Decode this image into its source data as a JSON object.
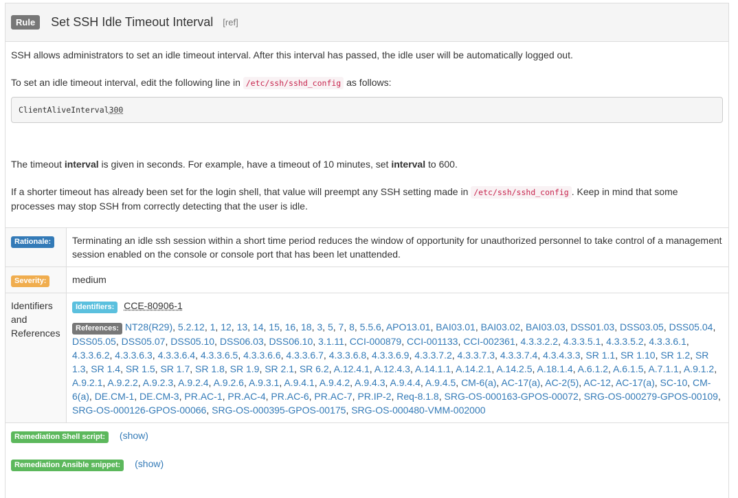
{
  "heading": {
    "badge": "Rule",
    "title": "Set SSH Idle Timeout Interval",
    "ref_link": "[ref]"
  },
  "description": {
    "p1": "SSH allows administrators to set an idle timeout interval. After this interval has passed, the idle user will be automatically logged out.",
    "p2_before": "To set an idle timeout interval, edit the following line in ",
    "p2_code": "/etc/ssh/sshd_config",
    "p2_after": " as follows:",
    "code_line": "ClientAliveInterval ",
    "code_value": "300",
    "p3_a": "The timeout ",
    "p3_b": "interval",
    "p3_c": " is given in seconds. For example, have a timeout of 10 minutes, set ",
    "p3_d": "interval",
    "p3_e": " to 600.",
    "p4_before": "If a shorter timeout has already been set for the login shell, that value will preempt any SSH setting made in ",
    "p4_code": "/etc/ssh/sshd_config",
    "p4_after": ". Keep in mind that some processes may stop SSH from correctly detecting that the user is idle."
  },
  "details": {
    "rationale_label": "Rationale:",
    "rationale_text": "Terminating an idle ssh session within a short time period reduces the window of opportunity for unauthorized personnel to take control of a management session enabled on the console or console port that has been let unattended.",
    "severity_label": "Severity:",
    "severity_value": "medium",
    "identifiers_heading": "Identifiers and References",
    "identifiers_label": "Identifiers:",
    "identifier_value": "CCE-80906-1",
    "references_label": "References:",
    "references": [
      "NT28(R29)",
      "5.2.12",
      "1",
      "12",
      "13",
      "14",
      "15",
      "16",
      "18",
      "3",
      "5",
      "7",
      "8",
      "5.5.6",
      "APO13.01",
      "BAI03.01",
      "BAI03.02",
      "BAI03.03",
      "DSS01.03",
      "DSS03.05",
      "DSS05.04",
      "DSS05.05",
      "DSS05.07",
      "DSS05.10",
      "DSS06.03",
      "DSS06.10",
      "3.1.11",
      "CCI-000879",
      "CCI-001133",
      "CCI-002361",
      "4.3.3.2.2",
      "4.3.3.5.1",
      "4.3.3.5.2",
      "4.3.3.6.1",
      "4.3.3.6.2",
      "4.3.3.6.3",
      "4.3.3.6.4",
      "4.3.3.6.5",
      "4.3.3.6.6",
      "4.3.3.6.7",
      "4.3.3.6.8",
      "4.3.3.6.9",
      "4.3.3.7.2",
      "4.3.3.7.3",
      "4.3.3.7.4",
      "4.3.4.3.3",
      "SR 1.1",
      "SR 1.10",
      "SR 1.2",
      "SR 1.3",
      "SR 1.4",
      "SR 1.5",
      "SR 1.7",
      "SR 1.8",
      "SR 1.9",
      "SR 2.1",
      "SR 6.2",
      "A.12.4.1",
      "A.12.4.3",
      "A.14.1.1",
      "A.14.2.1",
      "A.14.2.5",
      "A.18.1.4",
      "A.6.1.2",
      "A.6.1.5",
      "A.7.1.1",
      "A.9.1.2",
      "A.9.2.1",
      "A.9.2.2",
      "A.9.2.3",
      "A.9.2.4",
      "A.9.2.6",
      "A.9.3.1",
      "A.9.4.1",
      "A.9.4.2",
      "A.9.4.3",
      "A.9.4.4",
      "A.9.4.5",
      "CM-6(a)",
      "AC-17(a)",
      "AC-2(5)",
      "AC-12",
      "AC-17(a)",
      "SC-10",
      "CM-6(a)",
      "DE.CM-1",
      "DE.CM-3",
      "PR.AC-1",
      "PR.AC-4",
      "PR.AC-6",
      "PR.AC-7",
      "PR.IP-2",
      "Req-8.1.8",
      "SRG-OS-000163-GPOS-00072",
      "SRG-OS-000279-GPOS-00109",
      "SRG-OS-000126-GPOS-00066",
      "SRG-OS-000395-GPOS-00175",
      "SRG-OS-000480-VMM-002000"
    ],
    "remediation_shell_label": "Remediation Shell script:",
    "remediation_shell_link": "(show)",
    "remediation_ansible_label": "Remediation Ansible snippet:",
    "remediation_ansible_link": "(show)"
  }
}
